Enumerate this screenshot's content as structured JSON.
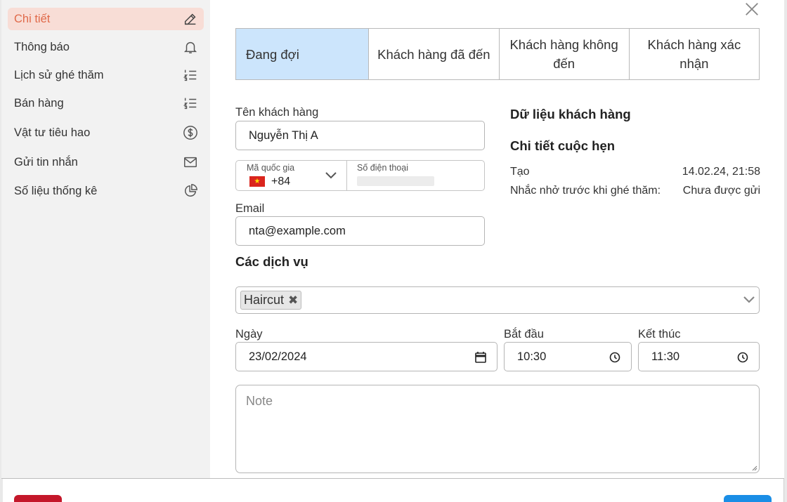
{
  "sidebar": {
    "items": [
      {
        "label": "Chi tiết",
        "icon": "pencil-icon",
        "active": true
      },
      {
        "label": "Thông báo",
        "icon": "bell-icon"
      },
      {
        "label": "Lịch sử ghé thăm",
        "icon": "numbered-list-icon"
      },
      {
        "label": "Bán hàng",
        "icon": "numbered-list-icon"
      },
      {
        "label": "Vật tư tiêu hao",
        "icon": "dollar-circle-icon"
      },
      {
        "label": "Gửi tin nhắn",
        "icon": "envelope-icon"
      },
      {
        "label": "Số liệu thống kê",
        "icon": "pie-chart-icon"
      }
    ]
  },
  "tabs": [
    {
      "label": "Đang đợi",
      "active": true
    },
    {
      "label": "Khách hàng đã đến"
    },
    {
      "label": "Khách hàng không đến"
    },
    {
      "label": "Khách hàng xác nhận"
    }
  ],
  "form": {
    "customer_name_label": "Tên khách hàng",
    "customer_name_value": "Nguyễn Thị A",
    "country_code_label": "Mã quốc gia",
    "country_code_value": "+84",
    "phone_label": "Số điện thoại",
    "email_label": "Email",
    "email_value": "nta@example.com",
    "services_title": "Các dịch vụ",
    "services_selected": [
      "Haircut"
    ],
    "date_label": "Ngày",
    "date_value": "23/02/2024",
    "start_label": "Bắt đầu",
    "start_value": "10:30",
    "end_label": "Kết thúc",
    "end_value": "11:30",
    "note_placeholder": "Note"
  },
  "details": {
    "customer_data_title": "Dữ liệu khách hàng",
    "appointment_title": "Chi tiết cuộc hẹn",
    "rows": [
      {
        "label": "Tạo",
        "value": "14.02.24, 21:58"
      },
      {
        "label": "Nhắc nhở trước khi ghé thăm:",
        "value": "Chưa được gửi"
      }
    ]
  },
  "colors": {
    "active_sidebar_bg": "#f8ddd6",
    "active_sidebar_text": "#e06a4a",
    "active_tab_bg": "#cce5fc",
    "delete_button": "#c4172a",
    "save_button": "#1a8ee6"
  }
}
